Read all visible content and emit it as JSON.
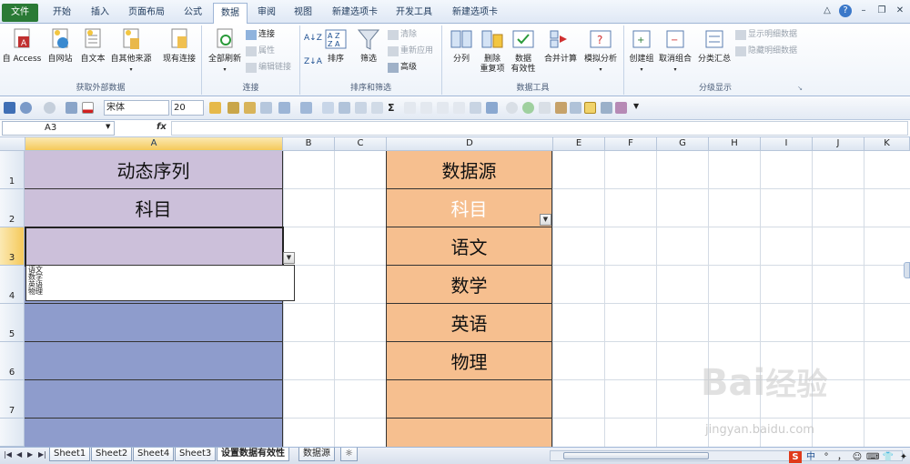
{
  "tabs": [
    "文件",
    "开始",
    "插入",
    "页面布局",
    "公式",
    "数据",
    "审阅",
    "视图",
    "新建选项卡",
    "开发工具",
    "新建选项卡"
  ],
  "ribbon": {
    "groups": {
      "external": "获取外部数据",
      "connect": "连接",
      "sort": "排序和筛选",
      "tools": "数据工具",
      "outline": "分级显示"
    },
    "buttons": {
      "access": "自 Access",
      "web": "自网站",
      "text": "自文本",
      "other": "自其他来源",
      "existing": "现有连接",
      "refresh": "全部刷新",
      "sort": "排序",
      "filter": "筛选",
      "split": "分列",
      "dedupe": "删除\n重复项",
      "validate": "数据\n有效性",
      "consolidate": "合并计算",
      "whatif": "模拟分析",
      "group": "创建组",
      "ungroup": "取消组合",
      "subtotal": "分类汇总"
    },
    "small": {
      "connections": "连接",
      "properties": "属性",
      "editlinks": "编辑链接",
      "clear": "清除",
      "reapply": "重新应用",
      "advanced": "高级",
      "showdetail": "显示明细数据",
      "hidedetail": "隐藏明细数据"
    }
  },
  "toolbar": {
    "font": "宋体",
    "size": "20"
  },
  "namebox": "A3",
  "columns": [
    "A",
    "B",
    "C",
    "D",
    "E",
    "F",
    "G",
    "H",
    "I",
    "J",
    "K"
  ],
  "rows": [
    "1",
    "2",
    "3",
    "4",
    "5",
    "6",
    "7"
  ],
  "cells": {
    "A1": "动态序列",
    "A2": "科目",
    "D1": "数据源",
    "D2": "科目",
    "D3": "语文",
    "D4": "数学",
    "D5": "英语",
    "D6": "物理"
  },
  "dropdown_list": [
    "语文",
    "数学",
    "英语",
    "物理"
  ],
  "sheets": [
    "Sheet1",
    "Sheet2",
    "Sheet4",
    "Sheet3",
    "设置数据有效性",
    "数据源"
  ],
  "watermark": {
    "main": "Bai",
    "second": "经验",
    "url": "jingyan.baidu.com"
  },
  "ime": [
    "S",
    "中",
    "°",
    "，",
    "☺",
    "⌨",
    "👕",
    "✦"
  ]
}
